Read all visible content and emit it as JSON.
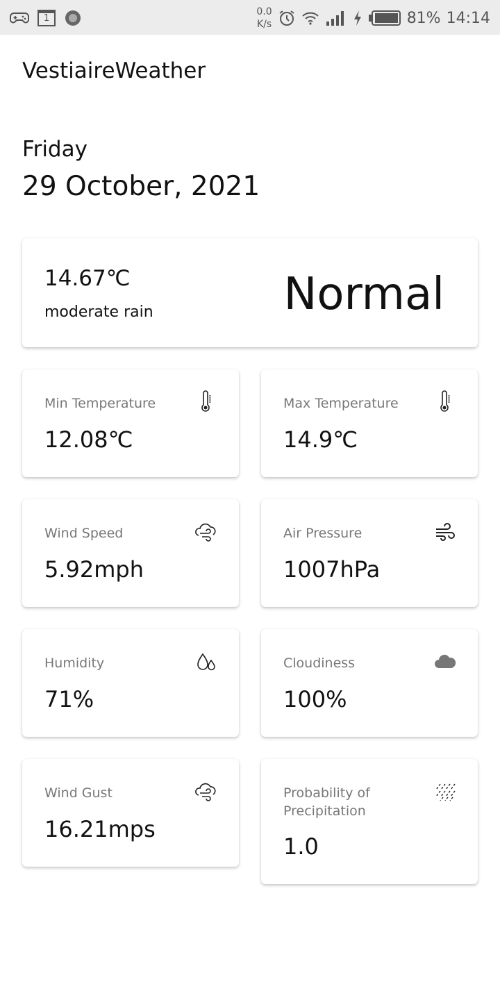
{
  "status_bar": {
    "icons_left": [
      "gamepad-icon",
      "calendar-icon",
      "record-icon"
    ],
    "calendar_day": "1",
    "net_speed_value": "0.0",
    "net_speed_unit": "K/s",
    "icons_right": [
      "alarm-icon",
      "wifi-icon",
      "signal-icon",
      "charging-icon",
      "battery-icon"
    ],
    "battery": "81%",
    "time": "14:14"
  },
  "app": {
    "title": "VestiaireWeather"
  },
  "date": {
    "day": "Friday",
    "full": "29 October, 2021"
  },
  "current": {
    "temperature": "14.67℃",
    "description": "moderate rain",
    "status": "Normal"
  },
  "tiles": [
    {
      "label": "Min Temperature",
      "value": "12.08℃",
      "icon": "thermometer-icon"
    },
    {
      "label": "Max Temperature",
      "value": "14.9℃",
      "icon": "thermometer-icon"
    },
    {
      "label": "Wind Speed",
      "value": "5.92mph",
      "icon": "wind-cloud-icon"
    },
    {
      "label": "Air Pressure",
      "value": "1007hPa",
      "icon": "wind-icon"
    },
    {
      "label": "Humidity",
      "value": "71%",
      "icon": "droplets-icon"
    },
    {
      "label": "Cloudiness",
      "value": "100%",
      "icon": "cloud-icon"
    },
    {
      "label": "Wind Gust",
      "value": "16.21mps",
      "icon": "wind-cloud-icon"
    },
    {
      "label": "Probability of Precipitation",
      "value": "1.0",
      "icon": "rain-icon"
    }
  ],
  "colors": {
    "status_bar_bg": "#ececec",
    "label_gray": "#777777",
    "text": "#111111"
  }
}
